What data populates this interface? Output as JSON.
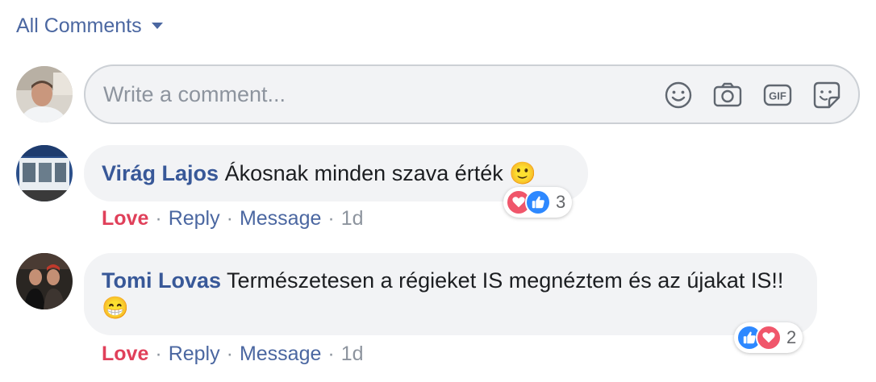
{
  "filter": {
    "label": "All Comments",
    "caret_icon": "caret-down-icon"
  },
  "composer": {
    "placeholder": "Write a comment...",
    "icons": [
      "emoji-icon",
      "camera-icon",
      "gif-icon",
      "sticker-icon"
    ]
  },
  "colors": {
    "link": "#4b67a1",
    "author": "#385898",
    "love": "#e0405a",
    "bubble": "#f2f3f5",
    "like": "#2d88ff"
  },
  "comments": [
    {
      "author": "Virág Lajos",
      "text": "Ákosnak minden szava érték",
      "emoji": "🙂",
      "actions": {
        "love": "Love",
        "reply": "Reply",
        "message": "Message",
        "time": "1d"
      },
      "reactions": {
        "types": [
          "love",
          "like"
        ],
        "count": "3"
      }
    },
    {
      "author": "Tomi Lovas",
      "text": "Természetesen a régieket IS megnéztem és az újakat IS!!",
      "emoji": "😁",
      "actions": {
        "love": "Love",
        "reply": "Reply",
        "message": "Message",
        "time": "1d"
      },
      "reactions": {
        "types": [
          "like",
          "love"
        ],
        "count": "2"
      }
    }
  ],
  "separator": "·"
}
